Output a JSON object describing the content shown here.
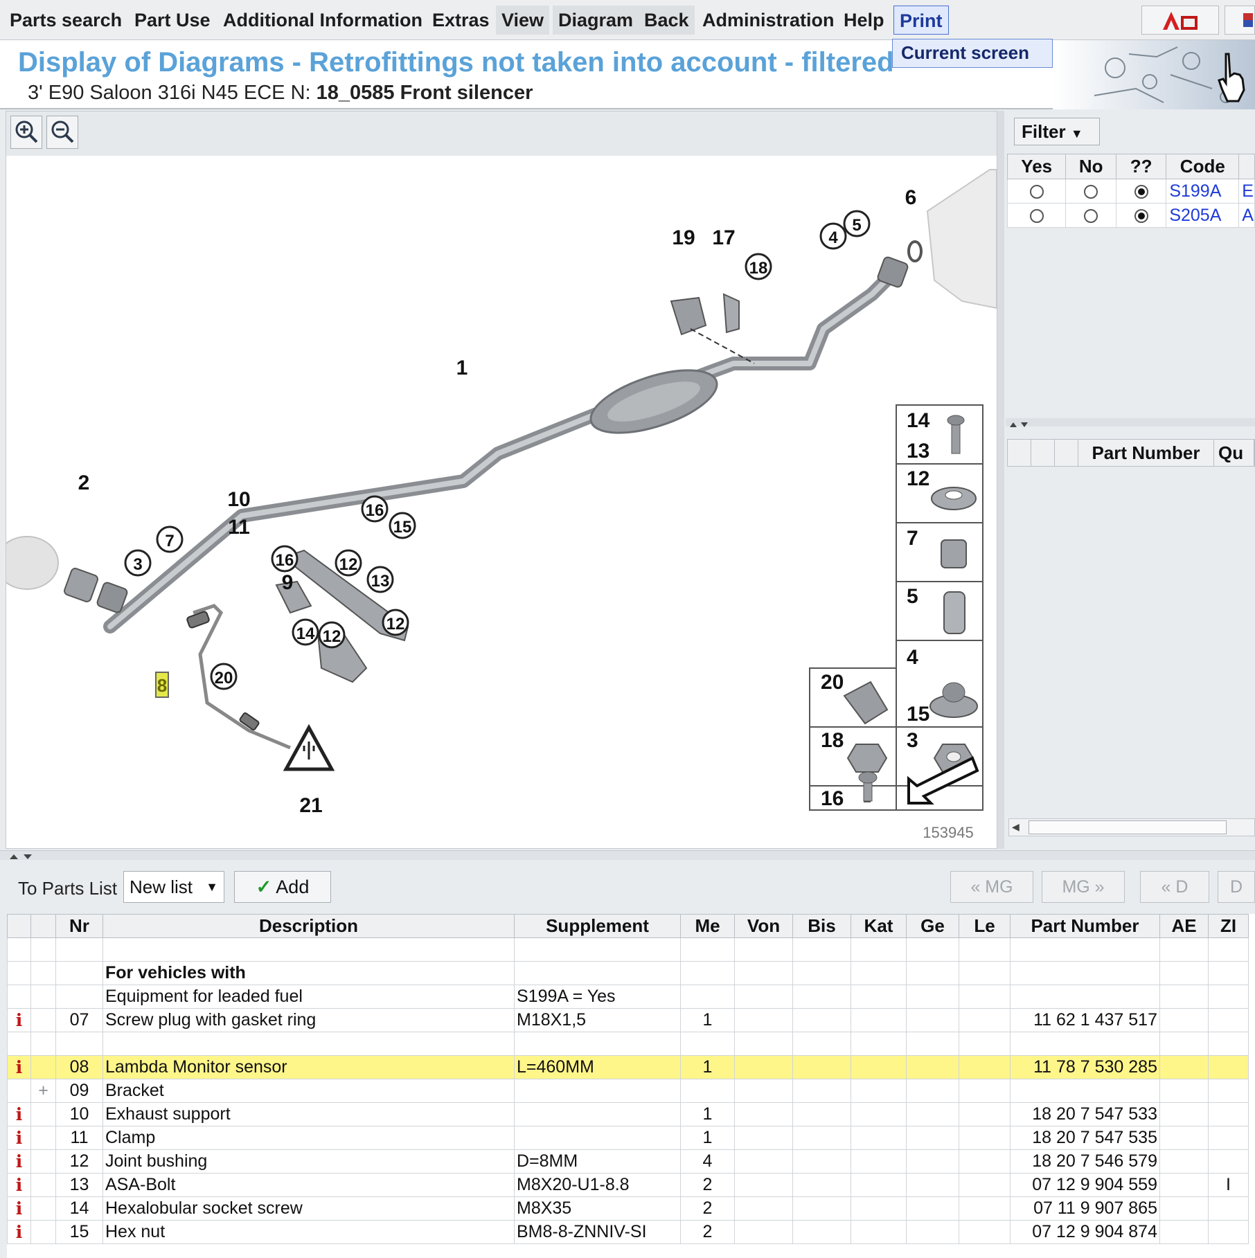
{
  "menu": {
    "items": [
      "Parts search",
      "Part Use",
      "Additional Information",
      "Extras",
      "View",
      "Diagram",
      "Back",
      "Administration",
      "Help",
      "Print"
    ],
    "print_dropdown": "Current screen"
  },
  "header": {
    "title": "Display of Diagrams - Retrofittings not taken into account - filtered",
    "vehicle": "3' E90 Saloon 316i N45 ECE",
    "n_prefix": "N:",
    "diagram_name": "18_0585 Front silencer"
  },
  "diagram": {
    "image_number": "153945",
    "callouts": [
      "1",
      "2",
      "3",
      "4",
      "5",
      "6",
      "7",
      "8",
      "9",
      "10",
      "11",
      "12",
      "13",
      "14",
      "15",
      "16",
      "17",
      "18",
      "19",
      "20",
      "21"
    ],
    "legend": [
      [
        "14",
        "13"
      ],
      [
        "12"
      ],
      [
        "7"
      ],
      [
        "5"
      ],
      [
        "4",
        "15"
      ],
      [
        "3"
      ],
      [
        "20"
      ],
      [
        "18"
      ],
      [
        "16"
      ]
    ]
  },
  "filter": {
    "button": "Filter",
    "headers": [
      "Yes",
      "No",
      "??",
      "Code",
      ""
    ],
    "rows": [
      {
        "code": "S199A",
        "desc": "E",
        "selected": 2
      },
      {
        "code": "S205A",
        "desc": "A",
        "selected": 2
      }
    ]
  },
  "right_parts": {
    "headers": [
      "",
      "",
      "",
      "Part Number",
      "Qu"
    ]
  },
  "list_toolbar": {
    "label": "To Parts List",
    "select_value": "New list",
    "add_label": "Add",
    "nav_buttons": [
      "« MG",
      "MG »",
      "« D",
      "D"
    ]
  },
  "parts": {
    "headers": [
      "",
      "",
      "Nr",
      "Description",
      "Supplement",
      "Me",
      "Von",
      "Bis",
      "Kat",
      "Ge",
      "Le",
      "Part Number",
      "AE",
      "ZI"
    ],
    "rows": [
      {
        "info": "",
        "plus": "",
        "nr": "",
        "desc": "",
        "supp": "",
        "me": "",
        "part": "",
        "zi": "",
        "bold": false,
        "hl": false
      },
      {
        "info": "",
        "plus": "",
        "nr": "",
        "desc": "For vehicles with",
        "supp": "",
        "me": "",
        "part": "",
        "zi": "",
        "bold": true,
        "hl": false
      },
      {
        "info": "",
        "plus": "",
        "nr": "",
        "desc": "Equipment for leaded fuel",
        "supp": "S199A = Yes",
        "me": "",
        "part": "",
        "zi": "",
        "bold": false,
        "hl": false
      },
      {
        "info": "i",
        "plus": "",
        "nr": "07",
        "desc": "Screw plug with gasket ring",
        "supp": "M18X1,5",
        "me": "1",
        "part": "11 62 1 437 517",
        "zi": "",
        "bold": false,
        "hl": false
      },
      {
        "info": "",
        "plus": "",
        "nr": "",
        "desc": "",
        "supp": "",
        "me": "",
        "part": "",
        "zi": "",
        "bold": false,
        "hl": false
      },
      {
        "info": "i",
        "plus": "",
        "nr": "08",
        "desc": "Lambda Monitor sensor",
        "supp": "L=460MM",
        "me": "1",
        "part": "11 78 7 530 285",
        "zi": "",
        "bold": false,
        "hl": true
      },
      {
        "info": "",
        "plus": "+",
        "nr": "09",
        "desc": "Bracket",
        "supp": "",
        "me": "",
        "part": "",
        "zi": "",
        "bold": false,
        "hl": false
      },
      {
        "info": "i",
        "plus": "",
        "nr": "10",
        "desc": "Exhaust support",
        "supp": "",
        "me": "1",
        "part": "18 20 7 547 533",
        "zi": "",
        "bold": false,
        "hl": false
      },
      {
        "info": "i",
        "plus": "",
        "nr": "11",
        "desc": "Clamp",
        "supp": "",
        "me": "1",
        "part": "18 20 7 547 535",
        "zi": "",
        "bold": false,
        "hl": false
      },
      {
        "info": "i",
        "plus": "",
        "nr": "12",
        "desc": "Joint bushing",
        "supp": "D=8MM",
        "me": "4",
        "part": "18 20 7 546 579",
        "zi": "",
        "bold": false,
        "hl": false
      },
      {
        "info": "i",
        "plus": "",
        "nr": "13",
        "desc": "ASA-Bolt",
        "supp": "M8X20-U1-8.8",
        "me": "2",
        "part": "07 12 9 904 559",
        "zi": "I",
        "bold": false,
        "hl": false
      },
      {
        "info": "i",
        "plus": "",
        "nr": "14",
        "desc": "Hexalobular socket screw",
        "supp": "M8X35",
        "me": "2",
        "part": "07 11 9 907 865",
        "zi": "",
        "bold": false,
        "hl": false
      },
      {
        "info": "i",
        "plus": "",
        "nr": "15",
        "desc": "Hex nut",
        "supp": "BM8-8-ZNNIV-SI",
        "me": "2",
        "part": "07 12 9 904 874",
        "zi": "",
        "bold": false,
        "hl": false
      }
    ]
  }
}
